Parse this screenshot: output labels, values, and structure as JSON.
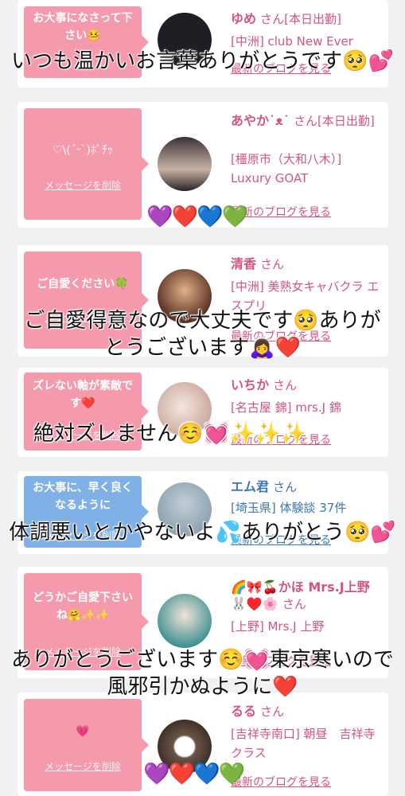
{
  "cards": [
    {
      "message": "お大事になさって下さい🤒",
      "delete": "",
      "name": "ゆめ",
      "san": "さん",
      "badge": "[本日出勤]",
      "location": "[中洲] club New Ever",
      "blog": "最新のブログを見る"
    },
    {
      "message": "♡\\(ˊᵕˋ)ﾎﾟﾁｯ",
      "delete": "メッセージを削除",
      "name": "あやか˙ᴥ˙",
      "san": "さん",
      "badge": "[本日出勤]",
      "location": "[橿原市（大和八木）] Luxury GOAT",
      "blog": "最新のブログを見る"
    },
    {
      "message": "ご自愛ください🍀",
      "delete": "メッセージを削除",
      "name": "清香",
      "san": "さん",
      "badge": "",
      "location": "[中洲] 美熟女キャバクラ エスプリ",
      "blog": "最新のブログを見る"
    },
    {
      "message": "ズレない軸が素敵です❤️",
      "delete": "メッセージを削除",
      "name": "いちか",
      "san": "さん",
      "badge": "",
      "location": "[名古屋 錦] mrs.J 錦",
      "blog": "最新のブログを見る"
    },
    {
      "message": "お大事に、早く良くなるように",
      "delete": "メッセージを削除",
      "name": "エム君",
      "san": "さん",
      "badge": "",
      "location": "[埼玉県] 体験談 37件",
      "blog": "最新のブログを見る"
    },
    {
      "message": "どうかご自愛下さいね🤗✨✨",
      "delete": "メッセージを削除",
      "name": "🌈🎀🍒かほ Mrs.J上野🐰♥️🌸",
      "san": "さん",
      "badge": "",
      "location": "[上野] Mrs.J 上野",
      "blog": "最新のブログを見る"
    },
    {
      "message": "💗",
      "delete": "メッセージを削除",
      "name": "るる",
      "san": "さん",
      "badge": "",
      "location": "[吉祥寺南口] 朝昼　吉祥寺クラス",
      "blog": "最新のブログを見る"
    }
  ],
  "overlays": {
    "o1": "いつも温かいお言葉ありがとうです🥺💕",
    "o2": "ご自愛得意なので大丈夫です🥺ありがとうございます🙇‍♀️❤️",
    "o3": "絶対ズレません☺️💓✨✨✨",
    "o4": "体調悪いとかやないよ💦ありがとう🥺💕",
    "o5": "ありがとうございます☺️💓東京寒いので風邪引かぬように❤️"
  },
  "hearts": "💜❤️💙💚"
}
